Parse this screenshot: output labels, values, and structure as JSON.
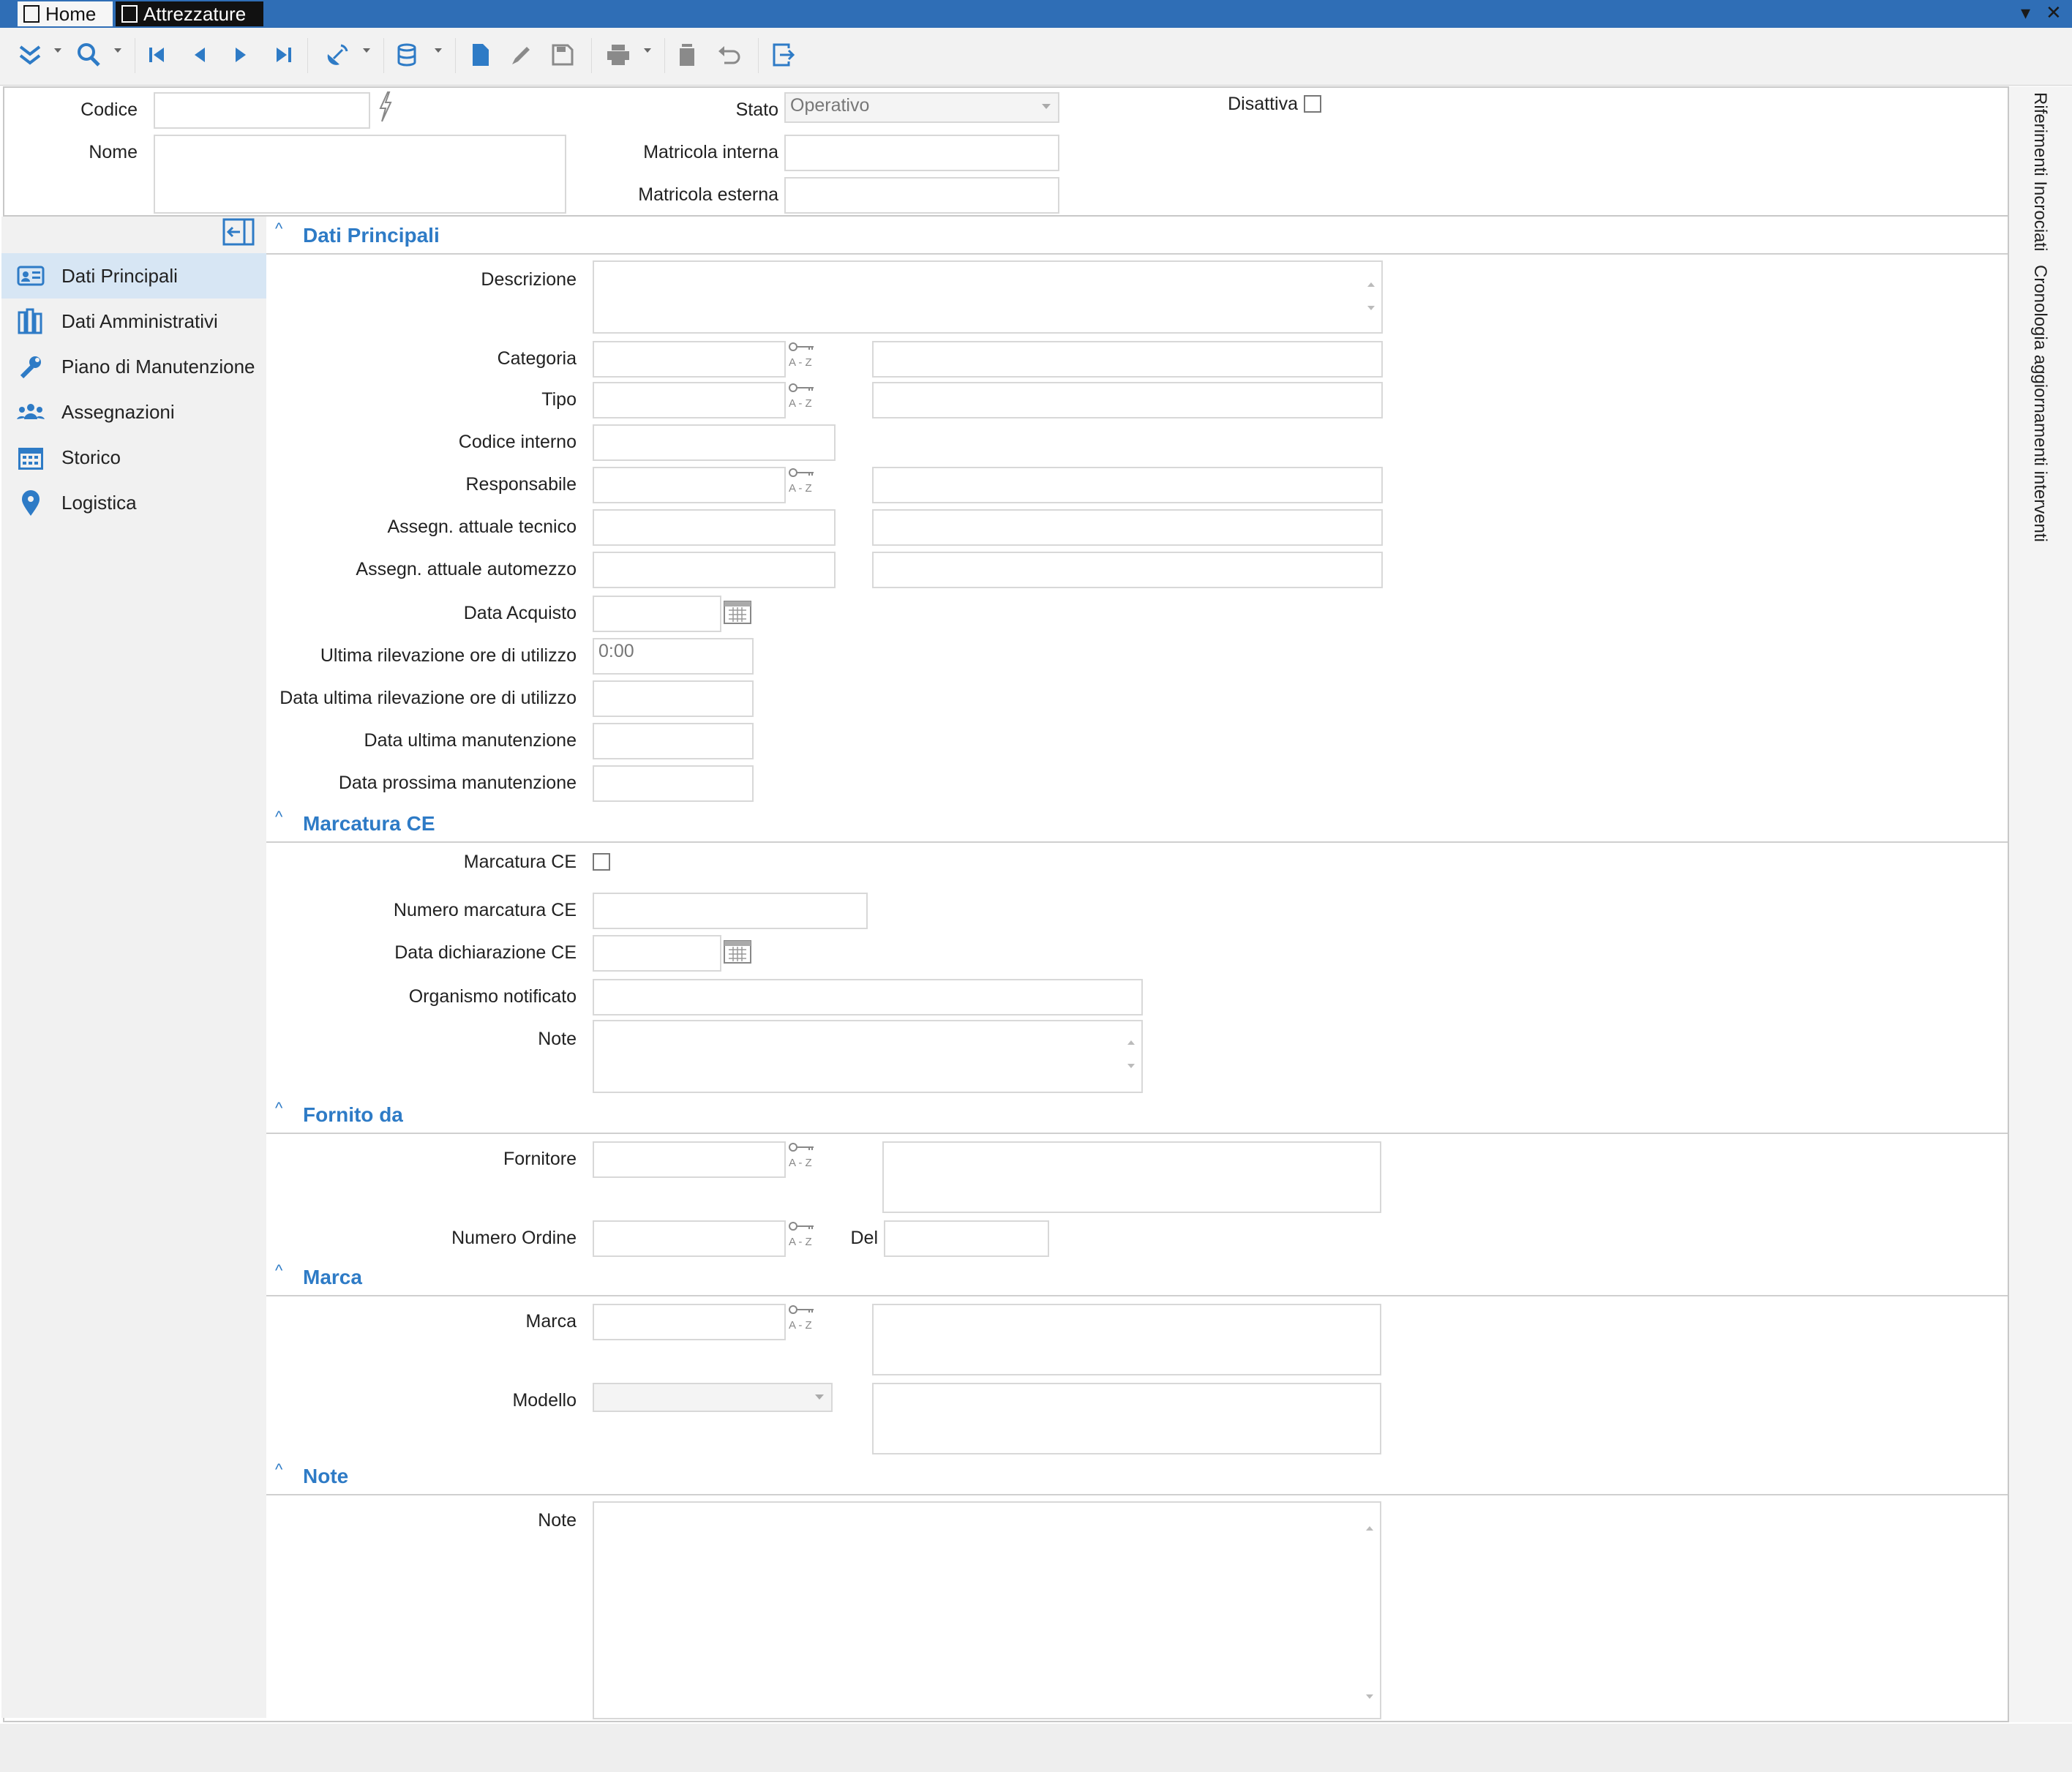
{
  "window": {
    "tabs": [
      {
        "label": "Home"
      },
      {
        "label": "Attrezzature"
      }
    ],
    "controls": {
      "dropdown": "▾",
      "close": "✕"
    }
  },
  "toolbar": {
    "icons": [
      "expand-icon",
      "search-icon",
      "first-record-icon",
      "previous-record-icon",
      "next-record-icon",
      "last-record-icon",
      "satellite-icon",
      "database-icon",
      "new-document-icon",
      "edit-icon",
      "save-icon",
      "print-icon",
      "delete-icon",
      "undo-icon",
      "exit-icon"
    ]
  },
  "header": {
    "codice_label": "Codice",
    "codice_value": "",
    "nome_label": "Nome",
    "nome_value": "",
    "stato_label": "Stato",
    "stato_value": "Operativo",
    "disattiva_label": "Disattiva",
    "matricola_interna_label": "Matricola interna",
    "matricola_esterna_label": "Matricola esterna"
  },
  "nav": {
    "items": [
      {
        "label": "Dati Principali",
        "icon": "id-card-icon",
        "active": true
      },
      {
        "label": "Dati Amministrativi",
        "icon": "books-icon",
        "active": false
      },
      {
        "label": "Piano di Manutenzione",
        "icon": "wrench-icon",
        "active": false
      },
      {
        "label": "Assegnazioni",
        "icon": "people-icon",
        "active": false
      },
      {
        "label": "Storico",
        "icon": "calendar-icon",
        "active": false
      },
      {
        "label": "Logistica",
        "icon": "location-pin-icon",
        "active": false
      }
    ]
  },
  "sections": {
    "dati_principali": {
      "title": "Dati Principali",
      "descrizione": "Descrizione",
      "categoria": "Categoria",
      "tipo": "Tipo",
      "codice_interno": "Codice interno",
      "responsabile": "Responsabile",
      "assegn_tecnico": "Assegn. attuale tecnico",
      "assegn_automezzo": "Assegn. attuale automezzo",
      "data_acquisto": "Data Acquisto",
      "ultima_rilevazione": "Ultima rilevazione ore di utilizzo",
      "ultima_rilevazione_value": "0:00",
      "data_ultima_rilevazione": "Data ultima rilevazione ore di utilizzo",
      "data_ultima_manutenzione": "Data ultima manutenzione",
      "data_prossima_manutenzione": "Data prossima manutenzione"
    },
    "marcatura_ce": {
      "title": "Marcatura CE",
      "marcatura_ce": "Marcatura CE",
      "numero_marcatura": "Numero marcatura CE",
      "data_dichiarazione": "Data dichiarazione CE",
      "organismo": "Organismo notificato",
      "note": "Note"
    },
    "fornito_da": {
      "title": "Fornito da",
      "fornitore": "Fornitore",
      "numero_ordine": "Numero Ordine",
      "del": "Del"
    },
    "marca": {
      "title": "Marca",
      "marca": "Marca",
      "modello": "Modello"
    },
    "note": {
      "title": "Note",
      "note": "Note"
    },
    "caret": "^"
  },
  "side_tabs": {
    "riferimenti": "Riferimenti Incrociati",
    "cronologia": "Cronologia aggiornamenti interventi"
  },
  "az_label": "A - Z",
  "colors": {
    "titlebar": "#2f6eb6",
    "accent": "#2e7bc6",
    "nav_active": "#d7e6f4"
  }
}
